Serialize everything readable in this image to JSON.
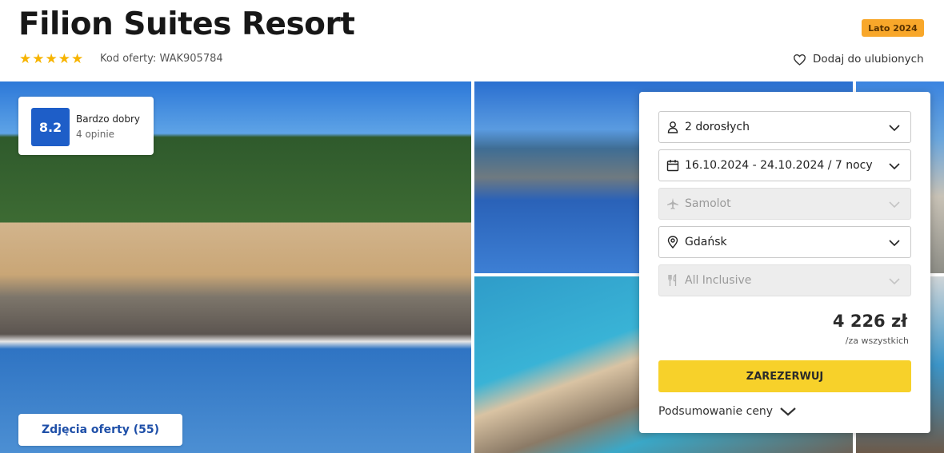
{
  "header": {
    "title": "Filion Suites Resort",
    "season_badge": "Lato 2024",
    "stars": 5,
    "offer_code": "Kod oferty: WAK905784",
    "favorite_label": "Dodaj do ulubionych"
  },
  "rating": {
    "score": "8.2",
    "label": "Bardzo dobry",
    "count": "4 opinie"
  },
  "gallery": {
    "photos_button": "Zdjęcia oferty (55)"
  },
  "booking": {
    "guests": "2 dorosłych",
    "dates": "16.10.2024 - 24.10.2024 / 7 nocy",
    "transport": "Samolot",
    "departure": "Gdańsk",
    "board": "All Inclusive",
    "price": "4 226 zł",
    "price_note": "/za wszystkich",
    "book_button": "ZAREZERWUJ",
    "summary_label": "Podsumowanie ceny"
  },
  "colors": {
    "accent_yellow": "#f7d12a",
    "rating_blue": "#1e5ec8",
    "season_orange": "#f8a72a",
    "star_gold": "#f7b400"
  }
}
